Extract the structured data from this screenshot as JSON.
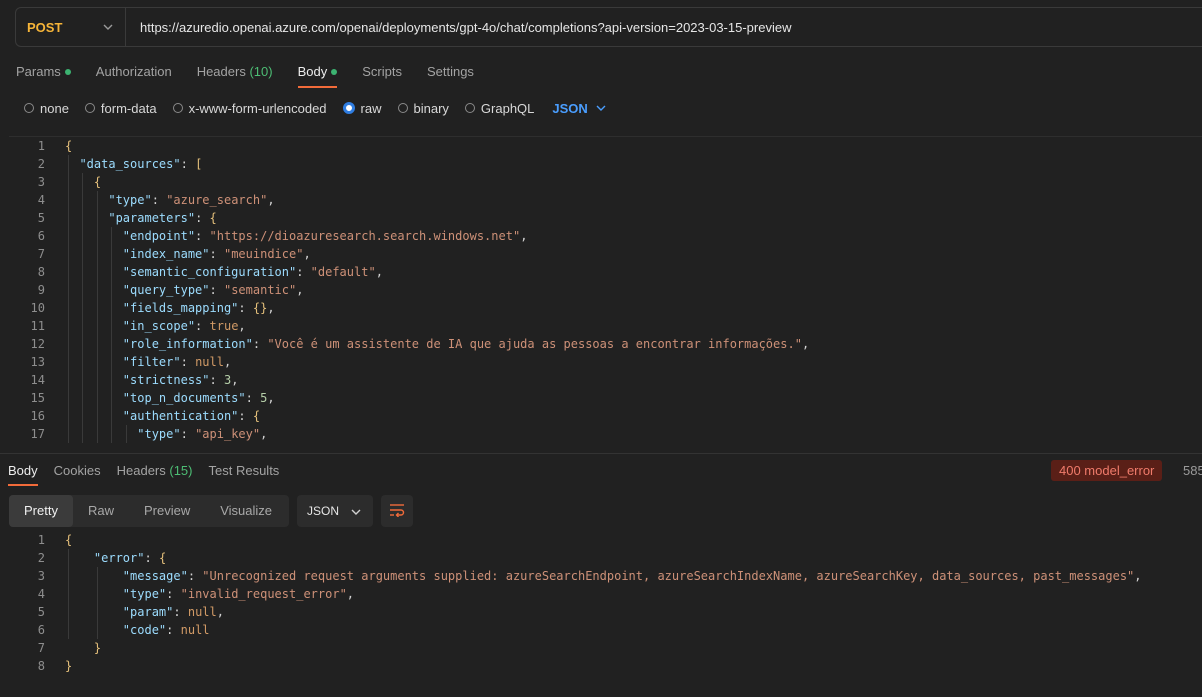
{
  "request": {
    "method": "POST",
    "url": "https://azuredio.openai.azure.com/openai/deployments/gpt-4o/chat/completions?api-version=2023-03-15-preview"
  },
  "request_tabs": {
    "params": "Params",
    "authorization": "Authorization",
    "headers": "Headers",
    "headers_count": "(10)",
    "body": "Body",
    "scripts": "Scripts",
    "settings": "Settings"
  },
  "body_types": {
    "none": "none",
    "form_data": "form-data",
    "urlencoded": "x-www-form-urlencoded",
    "raw": "raw",
    "binary": "binary",
    "graphql": "GraphQL",
    "language": "JSON",
    "selected": "raw"
  },
  "request_body_lines": [
    "{",
    "  \"data_sources\": [",
    "    {",
    "      \"type\": \"azure_search\",",
    "      \"parameters\": {",
    "        \"endpoint\": \"https://dioazuresearch.search.windows.net\",",
    "        \"index_name\": \"meuindice\",",
    "        \"semantic_configuration\": \"default\",",
    "        \"query_type\": \"semantic\",",
    "        \"fields_mapping\": {},",
    "        \"in_scope\": true,",
    "        \"role_information\": \"Você é um assistente de IA que ajuda as pessoas a encontrar informações.\",",
    "        \"filter\": null,",
    "        \"strictness\": 3,",
    "        \"top_n_documents\": 5,",
    "        \"authentication\": {",
    "          \"type\": \"api_key\","
  ],
  "response_tabs": {
    "body": "Body",
    "cookies": "Cookies",
    "headers": "Headers",
    "headers_count": "(15)",
    "test_results": "Test Results"
  },
  "response_status": "400 model_error",
  "response_size_partial": "585",
  "response_views": {
    "pretty": "Pretty",
    "raw": "Raw",
    "preview": "Preview",
    "visualize": "Visualize",
    "format": "JSON"
  },
  "response_body_lines": [
    "{",
    "    \"error\": {",
    "        \"message\": \"Unrecognized request arguments supplied: azureSearchEndpoint, azureSearchIndexName, azureSearchKey, data_sources, past_messages\",",
    "        \"type\": \"invalid_request_error\",",
    "        \"param\": null,",
    "        \"code\": null",
    "    }",
    "}"
  ],
  "colors": {
    "method": "#f7b538",
    "accent_tab": "#f26b3a",
    "link_blue": "#4a9eff",
    "error_badge_bg": "#5a1f17",
    "error_badge_fg": "#f07b6b"
  }
}
